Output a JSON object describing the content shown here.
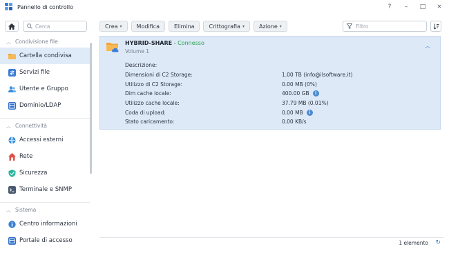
{
  "window": {
    "title": "Pannello di controllo",
    "controls": [
      "?",
      "–",
      "□",
      "×"
    ]
  },
  "sidebar": {
    "search_placeholder": "Cerca",
    "sections": [
      {
        "title": "Condivisione file",
        "items": [
          {
            "label": "Cartella condivisa",
            "icon": "shared-folder-icon",
            "active": true
          },
          {
            "label": "Servizi file",
            "icon": "file-services-icon"
          },
          {
            "label": "Utente e Gruppo",
            "icon": "user-group-icon"
          },
          {
            "label": "Dominio/LDAP",
            "icon": "domain-ldap-icon"
          }
        ]
      },
      {
        "title": "Connettività",
        "items": [
          {
            "label": "Accessi esterni",
            "icon": "external-access-icon"
          },
          {
            "label": "Rete",
            "icon": "network-icon"
          },
          {
            "label": "Sicurezza",
            "icon": "security-shield-icon"
          },
          {
            "label": "Terminale e SNMP",
            "icon": "terminal-icon"
          }
        ]
      },
      {
        "title": "Sistema",
        "items": [
          {
            "label": "Centro informazioni",
            "icon": "info-center-icon"
          },
          {
            "label": "Portale di accesso",
            "icon": "login-portal-icon"
          }
        ]
      }
    ]
  },
  "toolbar": {
    "crea": "Crea",
    "modifica": "Modifica",
    "elimina": "Elimina",
    "crittografia": "Crittografia",
    "azione": "Azione",
    "filter_placeholder": "Filtro"
  },
  "share": {
    "name": "HYBRID-SHARE",
    "separator": " - ",
    "status": "Connesso",
    "volume": "Volume 1",
    "properties": [
      {
        "label": "Descrizione:",
        "value": "",
        "info": false
      },
      {
        "label": "Dimensioni di C2 Storage:",
        "value": "1.00 TB (info@ilsoftware.it)",
        "info": false
      },
      {
        "label": "Utilizzo di C2 Storage:",
        "value": "0.00 MB (0%)",
        "info": false
      },
      {
        "label": "Dim cache locale:",
        "value": "400.00 GB",
        "info": true
      },
      {
        "label": "Utilizzo cache locale:",
        "value": "37.79 MB (0.01%)",
        "info": false
      },
      {
        "label": "Coda di upload:",
        "value": "0.00 MB",
        "info": true
      },
      {
        "label": "Stato caricamento:",
        "value": "0.00 KB/s",
        "info": false
      }
    ]
  },
  "footer": {
    "count": "1 elemento"
  },
  "colors": {
    "accent": "#4a8ad0",
    "selected_bg": "#dde9f7",
    "status_green": "#26a14a"
  }
}
